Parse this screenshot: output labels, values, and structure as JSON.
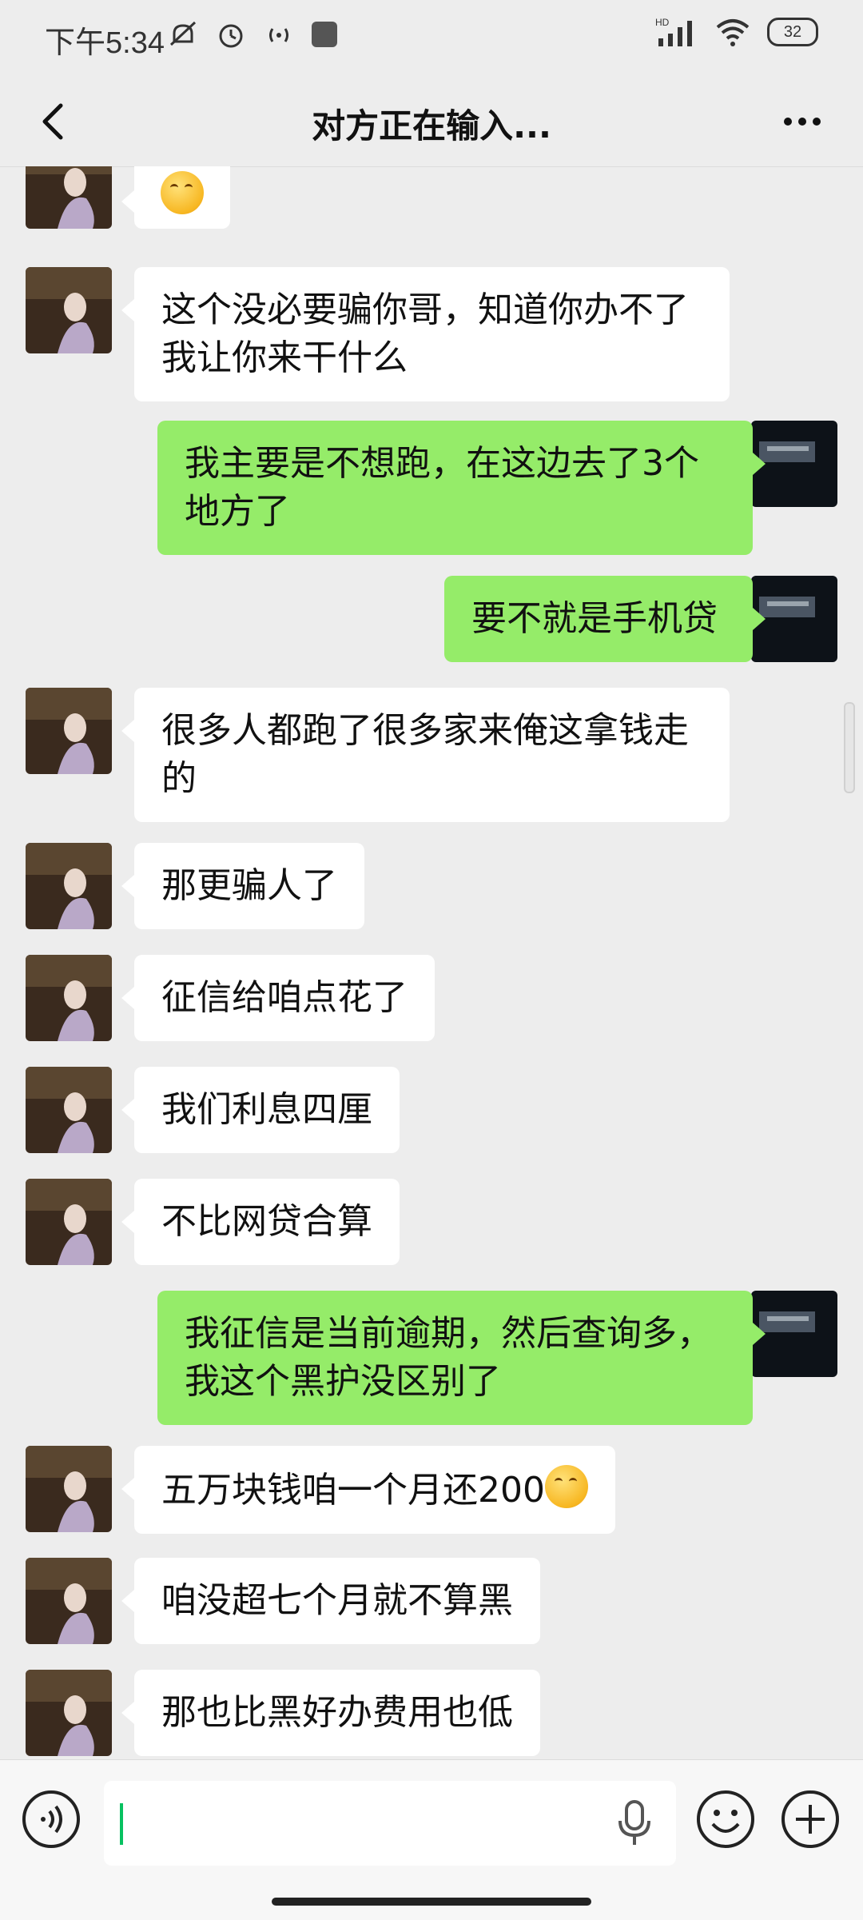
{
  "status_bar": {
    "time": "下午5:34",
    "battery": "32",
    "hd_label": "HD"
  },
  "header": {
    "title": "对方正在输入..."
  },
  "messages": [
    {
      "side": "left",
      "text": "",
      "emoji": true
    },
    {
      "side": "left",
      "text": "这个没必要骗你哥，知道你办不了我让你来干什么"
    },
    {
      "side": "right",
      "text": "我主要是不想跑，在这边去了3个地方了"
    },
    {
      "side": "right",
      "text": "要不就是手机贷"
    },
    {
      "side": "left",
      "text": "很多人都跑了很多家来俺这拿钱走的"
    },
    {
      "side": "left",
      "text": "那更骗人了"
    },
    {
      "side": "left",
      "text": "征信给咱点花了"
    },
    {
      "side": "left",
      "text": "我们利息四厘"
    },
    {
      "side": "left",
      "text": "不比网贷合算"
    },
    {
      "side": "right",
      "text": "我征信是当前逾期，然后查询多，我这个黑护没区别了"
    },
    {
      "side": "left",
      "text": "五万块钱咱一个月还200",
      "emoji_after": true
    },
    {
      "side": "left",
      "text": "咱没超七个月就不算黑"
    },
    {
      "side": "left",
      "text": "那也比黑好办费用也低"
    }
  ],
  "input": {
    "value": "",
    "placeholder": ""
  },
  "colors": {
    "background": "#ededed",
    "sent_bubble": "#95ec69",
    "received_bubble": "#ffffff",
    "caret": "#07c160"
  },
  "icons": {
    "back": "chevron-left-icon",
    "more": "more-dots-icon",
    "voice": "voice-mode-icon",
    "mic": "microphone-icon",
    "emoji": "emoji-icon",
    "plus": "plus-icon"
  }
}
